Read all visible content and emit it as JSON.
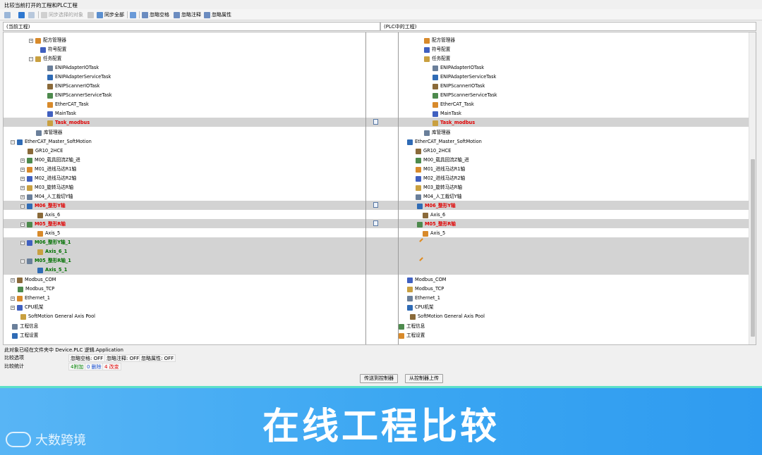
{
  "window": {
    "title": "比较当前打开的工程和PLC工程",
    "toolbar": {
      "sync_selected": "同步选择的对象",
      "sync_all": "同步全部",
      "ignore_whitespace": "忽略空格",
      "ignore_comments": "忽略注释",
      "ignore_properties": "忽略属性"
    },
    "header_left": "(当前工程)",
    "header_right": "(PLC中的工程)"
  },
  "left_tree": [
    {
      "label": "配方管理器",
      "style": "normal"
    },
    {
      "label": "符号配置",
      "style": "normal"
    },
    {
      "label": "任务配置",
      "style": "normal"
    },
    {
      "label": "ENIPAdapterIOTask",
      "style": "normal"
    },
    {
      "label": "ENIPAdapterServiceTask",
      "style": "normal"
    },
    {
      "label": "ENIPScannerIOTask",
      "style": "normal"
    },
    {
      "label": "ENIPScannerServiceTask",
      "style": "normal"
    },
    {
      "label": "EtherCAT_Task",
      "style": "normal"
    },
    {
      "label": "MainTask",
      "style": "normal"
    },
    {
      "label": "Task_modbus",
      "style": "red"
    },
    {
      "label": "库管理器",
      "style": "normal"
    },
    {
      "label": "EtherCAT_Master_SoftMotion",
      "style": "normal"
    },
    {
      "label": "GR10_2HCE",
      "style": "normal"
    },
    {
      "label": "M00_载具回流Z轴_进",
      "style": "normal"
    },
    {
      "label": "M01_进线马达R1轴",
      "style": "normal"
    },
    {
      "label": "M02_进线马达R2轴",
      "style": "normal"
    },
    {
      "label": "M03_旋转马达R轴",
      "style": "normal"
    },
    {
      "label": "M04_人工裁切Y轴",
      "style": "normal"
    },
    {
      "label": "M06_整形Y轴",
      "style": "red"
    },
    {
      "label": "Axis_6",
      "style": "normal"
    },
    {
      "label": "M05_整形R轴",
      "style": "red"
    },
    {
      "label": "Axis_5",
      "style": "normal"
    },
    {
      "label": "M06_整形Y轴_1",
      "style": "green"
    },
    {
      "label": "Axis_6_1",
      "style": "green"
    },
    {
      "label": "M05_整形R轴_1",
      "style": "green"
    },
    {
      "label": "Axis_5_1",
      "style": "green"
    },
    {
      "label": "Modbus_COM",
      "style": "normal"
    },
    {
      "label": "Modbus_TCP",
      "style": "normal"
    },
    {
      "label": "Ethernet_1",
      "style": "normal"
    },
    {
      "label": "CPU机架",
      "style": "normal"
    },
    {
      "label": "SoftMotion General Axis Pool",
      "style": "normal"
    },
    {
      "label": "工程信息",
      "style": "normal"
    },
    {
      "label": "工程设置",
      "style": "normal"
    }
  ],
  "right_tree": [
    {
      "label": "配方管理器"
    },
    {
      "label": "符号配置"
    },
    {
      "label": "任务配置"
    },
    {
      "label": "ENIPAdapterIOTask"
    },
    {
      "label": "ENIPAdapterServiceTask"
    },
    {
      "label": "ENIPScannerIOTask"
    },
    {
      "label": "ENIPScannerServiceTask"
    },
    {
      "label": "EtherCAT_Task"
    },
    {
      "label": "MainTask"
    },
    {
      "label": "Task_modbus"
    },
    {
      "label": "库管理器"
    },
    {
      "label": "EtherCAT_Master_SoftMotion"
    },
    {
      "label": "GR10_2HCE"
    },
    {
      "label": "M00_载具回流Z轴_进"
    },
    {
      "label": "M01_进线马达R1轴"
    },
    {
      "label": "M02_进线马达R2轴"
    },
    {
      "label": "M03_旋转马达R轴"
    },
    {
      "label": "M04_人工裁切Y轴"
    },
    {
      "label": "M06_整形Y轴"
    },
    {
      "label": "Axis_6"
    },
    {
      "label": "M05_整形R轴"
    },
    {
      "label": "Axis_5"
    },
    {
      "label": "Modbus_COM"
    },
    {
      "label": "Modbus_TCP"
    },
    {
      "label": "Ethernet_1"
    },
    {
      "label": "CPU机架"
    },
    {
      "label": "SoftMotion General Axis Pool"
    },
    {
      "label": "工程信息"
    },
    {
      "label": "工程设置"
    }
  ],
  "status": {
    "object_path": "此对象已经在文件夹中 Device.PLC 逻辑.Application",
    "compare_options_label": "比较选项",
    "ignore_ws": "忽略空格: OFF",
    "ignore_comments": "忽略注释: OFF",
    "ignore_props": "忽略属性: OFF",
    "stats_label": "比较统计",
    "added": "4附加",
    "deleted": "0 删除",
    "changed": "4 改变"
  },
  "buttons": {
    "download": "传送到控制器",
    "upload": "从控制器上传"
  },
  "banner": {
    "title": "在线工程比较",
    "logo_text": "大数跨境"
  }
}
